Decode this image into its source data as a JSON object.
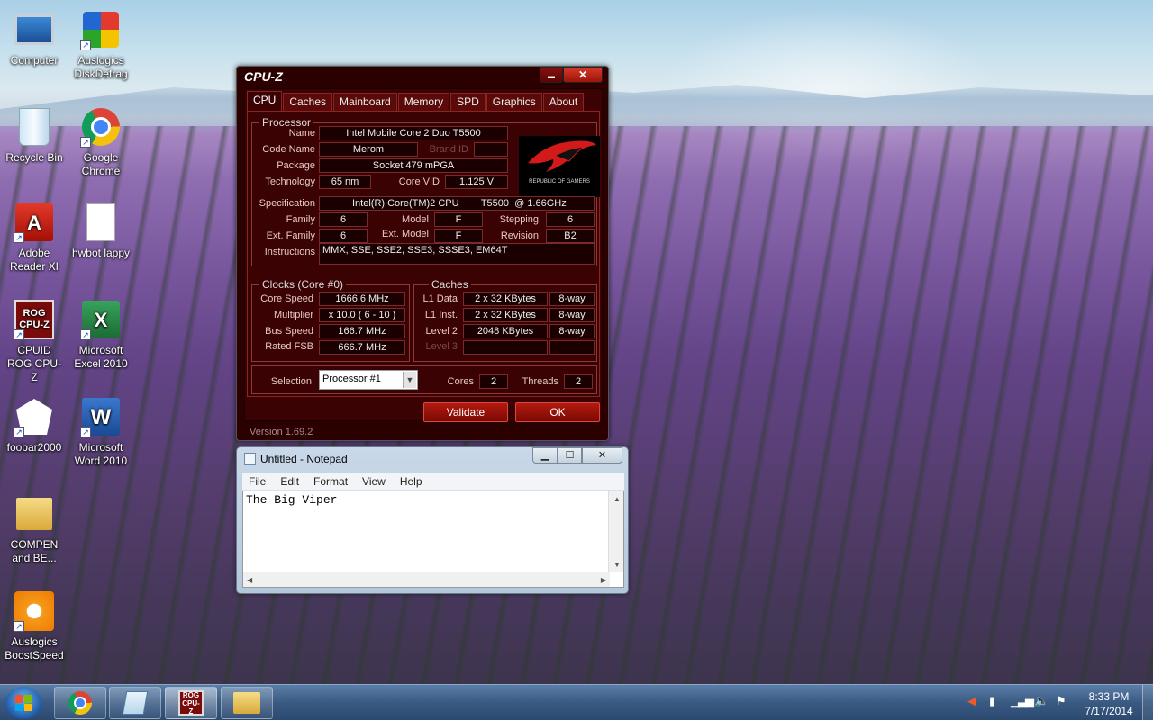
{
  "desktop": {
    "icons": [
      {
        "label": "Computer"
      },
      {
        "label": "Auslogics DiskDefrag"
      },
      {
        "label": "Recycle Bin"
      },
      {
        "label": "Google Chrome"
      },
      {
        "label": "Adobe Reader XI"
      },
      {
        "label": "hwbot lappy"
      },
      {
        "label": "CPUID ROG CPU-Z"
      },
      {
        "label": "Microsoft Excel 2010"
      },
      {
        "label": "foobar2000"
      },
      {
        "label": "Microsoft Word 2010"
      },
      {
        "label": "COMPEN and BE..."
      },
      {
        "label": "Auslogics BoostSpeed"
      }
    ],
    "rog_icon_text": "ROG CPU-Z"
  },
  "cpuz": {
    "title": "CPU-Z",
    "minimize": "▬",
    "close": "✕",
    "tabs": [
      "CPU",
      "Caches",
      "Mainboard",
      "Memory",
      "SPD",
      "Graphics",
      "About"
    ],
    "processor": {
      "group_title": "Processor",
      "name_label": "Name",
      "name": "Intel Mobile Core 2 Duo T5500",
      "codename_label": "Code Name",
      "codename": "Merom",
      "brandid_label": "Brand ID",
      "brandid": "",
      "package_label": "Package",
      "package": "Socket 479 mPGA",
      "technology_label": "Technology",
      "technology": "65 nm",
      "corevid_label": "Core VID",
      "corevid": "1.125 V",
      "spec_label": "Specification",
      "spec": "Intel(R) Core(TM)2 CPU        T5500  @ 1.66GHz",
      "family_label": "Family",
      "family": "6",
      "model_label": "Model",
      "model": "F",
      "stepping_label": "Stepping",
      "stepping": "6",
      "extfamily_label": "Ext. Family",
      "extfamily": "6",
      "extmodel_label": "Ext. Model",
      "extmodel": "F",
      "revision_label": "Revision",
      "revision": "B2",
      "instructions_label": "Instructions",
      "instructions": "MMX, SSE, SSE2, SSE3, SSSE3, EM64T"
    },
    "rog_logo_text": "REPUBLIC OF GAMERS",
    "clocks": {
      "group_title": "Clocks (Core #0)",
      "corespeed_label": "Core Speed",
      "corespeed": "1666.6 MHz",
      "multiplier_label": "Multiplier",
      "multiplier": "x 10.0 ( 6 - 10 )",
      "busspeed_label": "Bus Speed",
      "busspeed": "166.7 MHz",
      "ratedfsb_label": "Rated FSB",
      "ratedfsb": "666.7 MHz"
    },
    "caches": {
      "group_title": "Caches",
      "l1data_label": "L1 Data",
      "l1data": "2 x 32 KBytes",
      "l1data_way": "8-way",
      "l1inst_label": "L1 Inst.",
      "l1inst": "2 x 32 KBytes",
      "l1inst_way": "8-way",
      "level2_label": "Level 2",
      "level2": "2048 KBytes",
      "level2_way": "8-way",
      "level3_label": "Level 3",
      "level3": "",
      "level3_way": ""
    },
    "selection": {
      "label": "Selection",
      "value": "Processor #1",
      "cores_label": "Cores",
      "cores": "2",
      "threads_label": "Threads",
      "threads": "2"
    },
    "validate_label": "Validate",
    "ok_label": "OK",
    "version": "Version 1.69.2"
  },
  "notepad": {
    "title": "Untitled - Notepad",
    "menu": [
      "File",
      "Edit",
      "Format",
      "View",
      "Help"
    ],
    "content": "The Big Viper"
  },
  "taskbar": {
    "rog_text": "ROG CPU-Z",
    "time": "8:33 PM",
    "date": "7/17/2014"
  }
}
